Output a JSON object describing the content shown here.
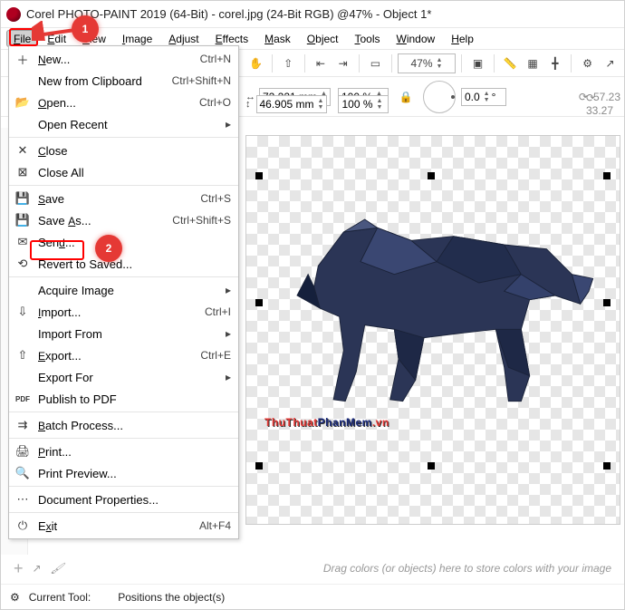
{
  "titlebar": {
    "title": "Corel PHOTO-PAINT 2019 (64-Bit) - corel.jpg (24-Bit RGB) @47% - Object 1*"
  },
  "menubar": {
    "items": [
      {
        "key": "F",
        "rest": "ile"
      },
      {
        "key": "E",
        "rest": "dit"
      },
      {
        "key": "V",
        "rest": "iew"
      },
      {
        "key": "I",
        "rest": "mage"
      },
      {
        "key": "A",
        "rest": "djust"
      },
      {
        "key": "E",
        "rest": "ffects"
      },
      {
        "key": "M",
        "rest": "ask"
      },
      {
        "key": "O",
        "rest": "bject"
      },
      {
        "key": "T",
        "rest": "ools"
      },
      {
        "key": "W",
        "rest": "indow"
      },
      {
        "key": "H",
        "rest": "elp"
      }
    ]
  },
  "toolbar1": {
    "zoom": "47%"
  },
  "toolbar2": {
    "x_label": "↔",
    "y_label": "↕",
    "x_value": "72.221 mm",
    "y_value": "46.905 mm",
    "scale_x": "100 %",
    "scale_y": "100 %",
    "angle": "0.0",
    "degree_suffix": "°",
    "info1": "57.23",
    "info2": "33.27"
  },
  "dropdown": {
    "items": [
      {
        "icon": "new",
        "u": "N",
        "rest": "ew...",
        "shortcut": "Ctrl+N"
      },
      {
        "icon": "",
        "u": "",
        "rest": "New from Clipboard",
        "shortcut": "Ctrl+Shift+N"
      },
      {
        "icon": "open",
        "u": "O",
        "rest": "pen...",
        "shortcut": "Ctrl+O"
      },
      {
        "icon": "",
        "u": "",
        "rest": "Open Recent",
        "shortcut": "",
        "submenu": true
      },
      {
        "sep": true
      },
      {
        "icon": "close",
        "u": "C",
        "rest": "lose",
        "shortcut": ""
      },
      {
        "icon": "closeall",
        "u": "",
        "rest": "Close All",
        "shortcut": ""
      },
      {
        "sep": true
      },
      {
        "icon": "save",
        "u": "S",
        "rest": "ave",
        "shortcut": "Ctrl+S"
      },
      {
        "icon": "saveas",
        "u": "",
        "rest": "Save As...",
        "shortcut": "Ctrl+Shift+S",
        "highlight": true,
        "u2": "A"
      },
      {
        "icon": "send",
        "u": "",
        "rest": "Send...",
        "shortcut": "",
        "u2": "d"
      },
      {
        "icon": "revert",
        "u": "",
        "rest": "Revert to Saved...",
        "shortcut": ""
      },
      {
        "sep": true
      },
      {
        "icon": "",
        "u": "",
        "rest": "Acquire Image",
        "shortcut": "",
        "submenu": true
      },
      {
        "icon": "import",
        "u": "I",
        "rest": "mport...",
        "shortcut": "Ctrl+I"
      },
      {
        "icon": "",
        "u": "",
        "rest": "Import From",
        "shortcut": "",
        "submenu": true
      },
      {
        "icon": "export",
        "u": "E",
        "rest": "xport...",
        "shortcut": "Ctrl+E"
      },
      {
        "icon": "",
        "u": "",
        "rest": "Export For",
        "shortcut": "",
        "submenu": true
      },
      {
        "icon": "pdf",
        "u": "",
        "rest": "Publish to PDF",
        "shortcut": ""
      },
      {
        "sep": true
      },
      {
        "icon": "batch",
        "u": "B",
        "rest": "atch Process...",
        "shortcut": ""
      },
      {
        "sep": true
      },
      {
        "icon": "print",
        "u": "P",
        "rest": "rint...",
        "shortcut": ""
      },
      {
        "icon": "printprev",
        "u": "",
        "rest": "Print Preview...",
        "shortcut": ""
      },
      {
        "sep": true
      },
      {
        "icon": "docprop",
        "u": "",
        "rest": "Document Properties...",
        "shortcut": ""
      },
      {
        "sep": true
      },
      {
        "icon": "exit",
        "u": "",
        "rest": "Exit",
        "shortcut": "Alt+F4",
        "u2": "x"
      }
    ]
  },
  "callouts": {
    "one": "1",
    "two": "2"
  },
  "watermark": {
    "part1": "ThuThuat",
    "part2": "PhanMem",
    "part3": ".vn"
  },
  "colorstrip": {
    "hint": "Drag colors (or objects) here to store colors with your image",
    "plus": "+"
  },
  "statusbar": {
    "label": "Current Tool:",
    "value": "Positions the object(s)"
  },
  "icons": {
    "new": "＋",
    "open": "📂",
    "close": "✕",
    "closeall": "⊠",
    "save": "💾",
    "saveas": "💾",
    "send": "✉",
    "revert": "⟲",
    "import": "⇩",
    "export": "⇧",
    "pdf": "PDF",
    "batch": "⇉",
    "print": "🖨",
    "printprev": "🔍",
    "docprop": "⋯",
    "exit": "⏻",
    "gear": "⚙",
    "lock": "🔒",
    "brush": "🖌",
    "eyedrop": "💧"
  }
}
